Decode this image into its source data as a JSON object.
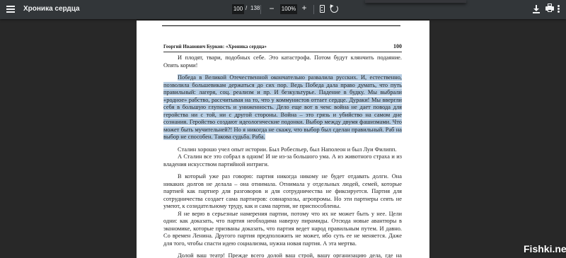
{
  "toolbar": {
    "title": "Хроника сердца",
    "current_page": "100",
    "page_separator": "/",
    "total_pages": "138",
    "zoom_minus": "−",
    "zoom_level": "100%",
    "zoom_plus": "+",
    "icons": [
      "menu-icon",
      "fit-page-icon",
      "rotate-icon",
      "download-icon",
      "print-icon",
      "more-options-icon"
    ]
  },
  "document": {
    "running_head": "Георгий Иванович Бурков: «Хроника сердца»",
    "page_number": "100",
    "paragraphs": [
      "И плодят, твари, подобных себе. Это катастрофа. Потом будут клянчить подаяние. Опять корми!",
      "Победа в Великой Отечественной окончательно развалила русских. И, естественно, позволила большевикам держаться до сих пор. Ведь Победа дала право думать, что путь правильный: лагеря, соц. реализм и пр. И безкультурье. Падение в будку. Мы выбрали «родное» рабство, рассчитывая на то, что у коммунистов оттает сердце. Дураки! Мы ввергли себя в большую глупость и униженность. Дело еще вот в чем: война не дает повода для геройства ни с той, ни с другой стороны. Война – это грязь и убийство на самом дне сознания. Геройство создают идеологические подонки. Выбор между двумя фашизмами. Что может быть мучительней?! Но я никогда не скажу, что выбор был сделан правильный. Раб на выбор не способен. Такова судьба. Раба.",
      "Сталин хорошо учел опыт истории. Был Робеспьер, был Наполеон и был Луи Филипп.",
      "А Сталин все это собрал в одном! И не из-за большого ума. А из животного страха и из владения искусством партийной интриги.",
      "В который уже раз говорю: партия никогда никому не будет отдавать долги. Она никаких долгов не делала – она отнимала. Отнимала у отдельных людей, семей, которые партией как партнер для разговоров и для сотрудничества не фиксируется. Партия для сотрудничества создает сама партнеров: совнархозы, агропромы. Но эти партнеры сеять не умеют, к созидательному труду, как и сама партия, не приспособлены.",
      "Я не верю в серьезные намерения партии, потому что их не может быть у нее. Цели одни: как доказать, что партия необходима наверху пирамиды. Отсюда новые авантюры в экономике, которые призваны доказать, что партия ведет народ правильным путем. И давно. Со времен Ленина. Другого партия предположить не может, ибо суть ее не меняется. Даже для того, чтобы спасти идею социализма, нужна новая партия. А эта мертва.",
      "Долой ваш театр! Прежде всего долой ваш строй, вашу организацию дела, где на первом"
    ]
  },
  "watermark": "Fishki.net",
  "colors": {
    "toolbar_bg": "#323639",
    "viewer_bg": "#282828",
    "page_bg": "#ffffff",
    "selection": "#b6cde3"
  }
}
